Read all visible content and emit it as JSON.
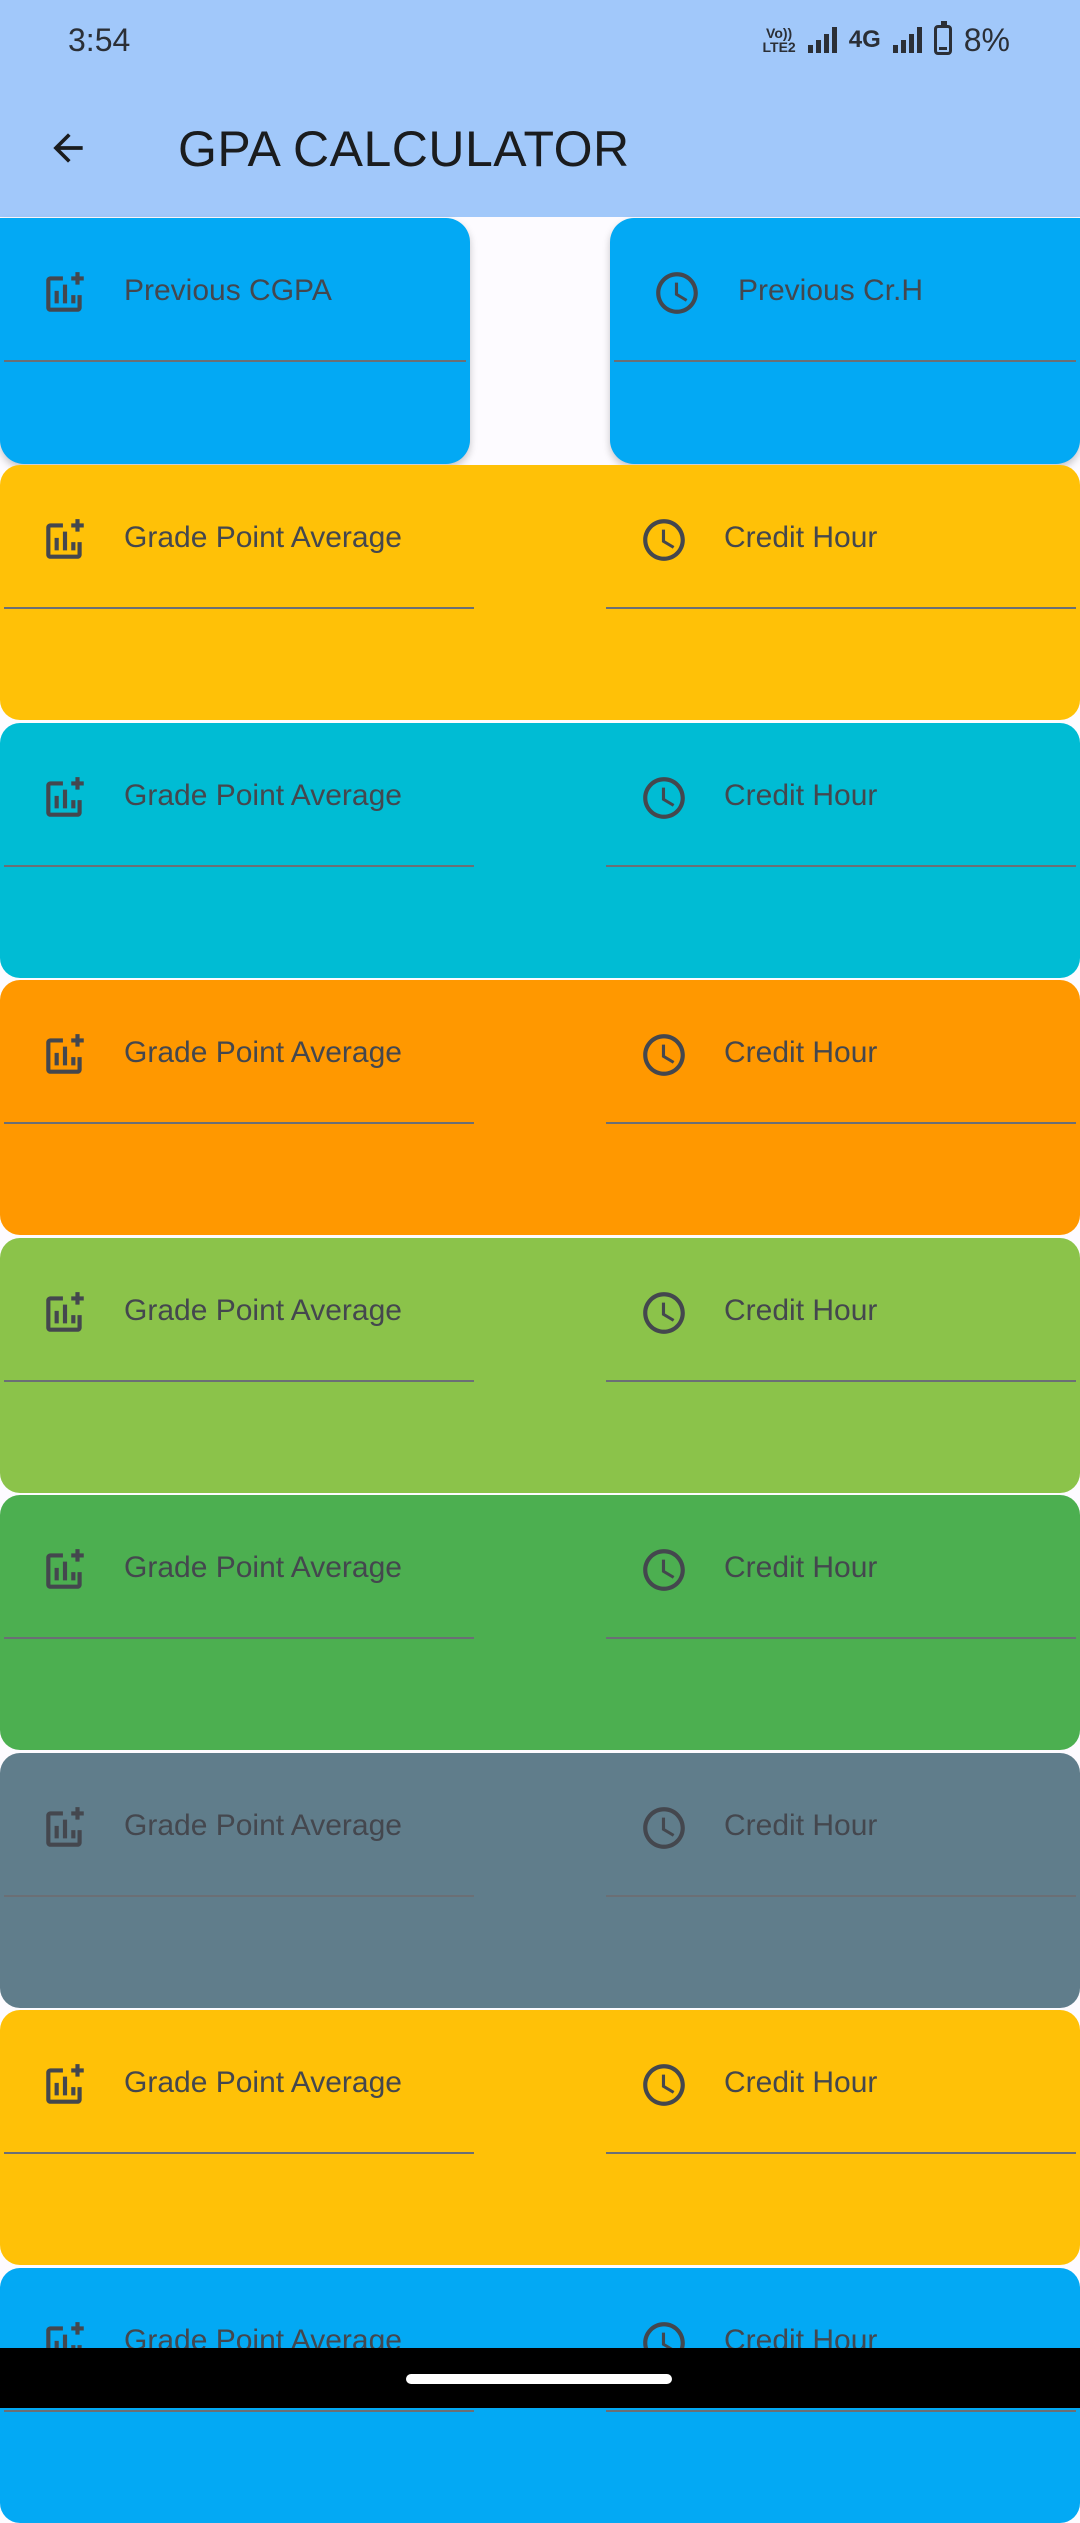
{
  "status_bar": {
    "time": "3:54",
    "volte_top": "Vo))",
    "volte_bottom": "LTE2",
    "network": "4G",
    "battery_percent": "8%"
  },
  "app_bar": {
    "back_icon": "arrow-back-icon",
    "title": "GPA CALCULATOR"
  },
  "icons": {
    "gpa": "chart-add-icon",
    "credit": "clock-icon"
  },
  "previous": {
    "cgpa_label": "Previous CGPA",
    "credit_label": "Previous Cr.H",
    "color": "#03a9f4"
  },
  "rows": [
    {
      "gpa_label": "Grade Point Average",
      "credit_label": "Credit Hour",
      "color": "#ffc107"
    },
    {
      "gpa_label": "Grade Point Average",
      "credit_label": "Credit Hour",
      "color": "#00bcd4"
    },
    {
      "gpa_label": "Grade Point Average",
      "credit_label": "Credit Hour",
      "color": "#ff9800"
    },
    {
      "gpa_label": "Grade Point Average",
      "credit_label": "Credit Hour",
      "color": "#8bc34a"
    },
    {
      "gpa_label": "Grade Point Average",
      "credit_label": "Credit Hour",
      "color": "#4caf50"
    },
    {
      "gpa_label": "Grade Point Average",
      "credit_label": "Credit Hour",
      "color": "#607d8b"
    },
    {
      "gpa_label": "Grade Point Average",
      "credit_label": "Credit Hour",
      "color": "#ffc107"
    },
    {
      "gpa_label": "Grade Point Average",
      "credit_label": "Credit Hour",
      "color": "#03a9f4"
    }
  ]
}
